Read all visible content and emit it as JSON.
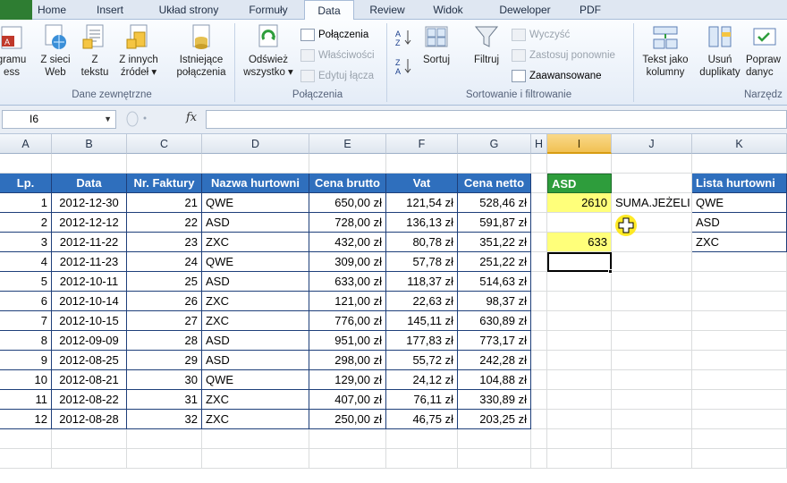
{
  "ribbon_tabs": [
    "Home",
    "Insert",
    "Układ strony",
    "Formuły",
    "Data",
    "Review",
    "Widok",
    "Deweloper",
    "PDF"
  ],
  "active_tab": "Data",
  "ribbon": {
    "get_external": {
      "from_access": "gramu\ness",
      "from_web": "Z sieci\nWeb",
      "from_text": "Z\ntekstu",
      "from_other": "Z innych\nźródeł ▾",
      "existing": "Istniejące\npołączenia",
      "group_label": "Dane zewnętrzne"
    },
    "connections": {
      "refresh": "Odśwież\nwszystko ▾",
      "connections": "Połączenia",
      "properties": "Właściwości",
      "edit_links": "Edytuj łącza",
      "group_label": "Połączenia"
    },
    "sort_filter": {
      "sort": "Sortuj",
      "filter": "Filtruj",
      "clear": "Wyczyść",
      "reapply": "Zastosuj ponownie",
      "advanced": "Zaawansowane",
      "group_label": "Sortowanie i filtrowanie"
    },
    "tools": {
      "text_to_columns": "Tekst jako\nkolumny",
      "remove_duplicates": "Usuń\nduplikaty",
      "data_validation": "Popraw\ndanyc",
      "group_label": "Narzędz"
    }
  },
  "formula_bar": {
    "name_box": "I6",
    "fx": "fx",
    "formula": ""
  },
  "columns": [
    "A",
    "B",
    "C",
    "D",
    "E",
    "F",
    "G",
    "H",
    "I",
    "J",
    "K"
  ],
  "selected_column": "I",
  "table": {
    "headers": [
      "Lp.",
      "Data",
      "Nr. Faktury",
      "Nazwa hurtowni",
      "Cena brutto",
      "Vat",
      "Cena netto"
    ],
    "rows": [
      [
        "1",
        "2012-12-30",
        "21",
        "QWE",
        "650,00 zł",
        "121,54 zł",
        "528,46 zł"
      ],
      [
        "2",
        "2012-12-12",
        "22",
        "ASD",
        "728,00 zł",
        "136,13 zł",
        "591,87 zł"
      ],
      [
        "3",
        "2012-11-22",
        "23",
        "ZXC",
        "432,00 zł",
        "80,78 zł",
        "351,22 zł"
      ],
      [
        "4",
        "2012-11-23",
        "24",
        "QWE",
        "309,00 zł",
        "57,78 zł",
        "251,22 zł"
      ],
      [
        "5",
        "2012-10-11",
        "25",
        "ASD",
        "633,00 zł",
        "118,37 zł",
        "514,63 zł"
      ],
      [
        "6",
        "2012-10-14",
        "26",
        "ZXC",
        "121,00 zł",
        "22,63 zł",
        "98,37 zł"
      ],
      [
        "7",
        "2012-10-15",
        "27",
        "ZXC",
        "776,00 zł",
        "145,11 zł",
        "630,89 zł"
      ],
      [
        "8",
        "2012-09-09",
        "28",
        "ASD",
        "951,00 zł",
        "177,83 zł",
        "773,17 zł"
      ],
      [
        "9",
        "2012-08-25",
        "29",
        "ASD",
        "298,00 zł",
        "55,72 zł",
        "242,28 zł"
      ],
      [
        "10",
        "2012-08-21",
        "30",
        "QWE",
        "129,00 zł",
        "24,12 zł",
        "104,88 zł"
      ],
      [
        "11",
        "2012-08-22",
        "31",
        "ZXC",
        "407,00 zł",
        "76,11 zł",
        "330,89 zł"
      ],
      [
        "12",
        "2012-08-28",
        "32",
        "ZXC",
        "250,00 zł",
        "46,75 zł",
        "203,25 zł"
      ]
    ]
  },
  "side": {
    "i_header": "ASD",
    "i_value1": "2610",
    "j_label": "SUMA.JEŻELI",
    "i_value2": "633",
    "list_header": "Lista hurtowni",
    "list": [
      "QWE",
      "ASD",
      "ZXC"
    ]
  },
  "colors": {
    "header_blue": "#2f6fbd",
    "asd_green": "#2e9d3c",
    "highlight_yellow": "#ffff7a",
    "table_border": "#1e3f7a"
  }
}
